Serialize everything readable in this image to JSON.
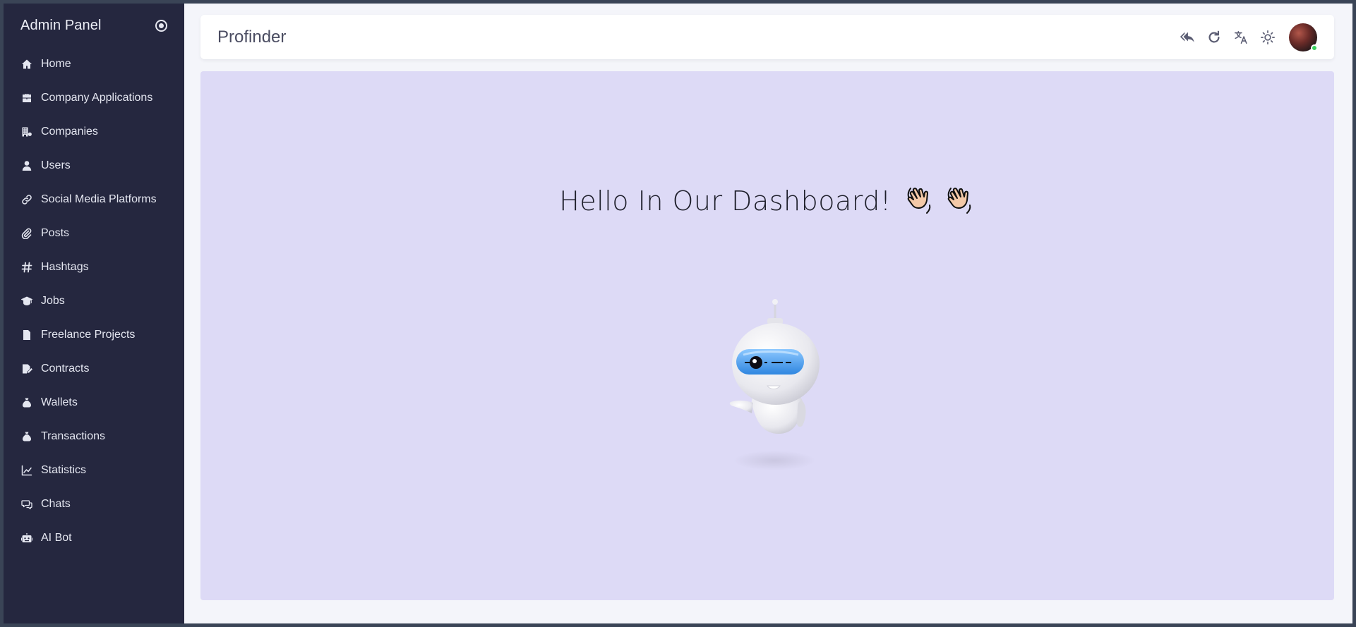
{
  "sidebar": {
    "brand": "Admin Panel",
    "items": [
      {
        "label": "Home",
        "icon": "home-icon"
      },
      {
        "label": "Company Applications",
        "icon": "briefcase-icon"
      },
      {
        "label": "Companies",
        "icon": "building-icon"
      },
      {
        "label": "Users",
        "icon": "user-icon"
      },
      {
        "label": "Social Media Platforms",
        "icon": "link-icon"
      },
      {
        "label": "Posts",
        "icon": "paperclip-icon"
      },
      {
        "label": "Hashtags",
        "icon": "hashtag-icon"
      },
      {
        "label": "Jobs",
        "icon": "graduation-cap-icon"
      },
      {
        "label": "Freelance Projects",
        "icon": "file-edit-icon"
      },
      {
        "label": "Contracts",
        "icon": "contract-icon"
      },
      {
        "label": "Wallets",
        "icon": "money-bag-icon"
      },
      {
        "label": "Transactions",
        "icon": "money-bag-icon"
      },
      {
        "label": "Statistics",
        "icon": "chart-line-icon"
      },
      {
        "label": "Chats",
        "icon": "chat-icon"
      },
      {
        "label": "AI Bot",
        "icon": "robot-icon"
      }
    ]
  },
  "header": {
    "title": "Profinder",
    "actions": [
      "reply-all-icon",
      "refresh-icon",
      "translate-icon",
      "sun-icon",
      "avatar"
    ]
  },
  "main": {
    "greeting": "Hello In Our Dashboard!"
  },
  "colors": {
    "sidebar_bg": "#25273f",
    "content_bg": "#dddaf6",
    "online_status": "#38d15c"
  }
}
